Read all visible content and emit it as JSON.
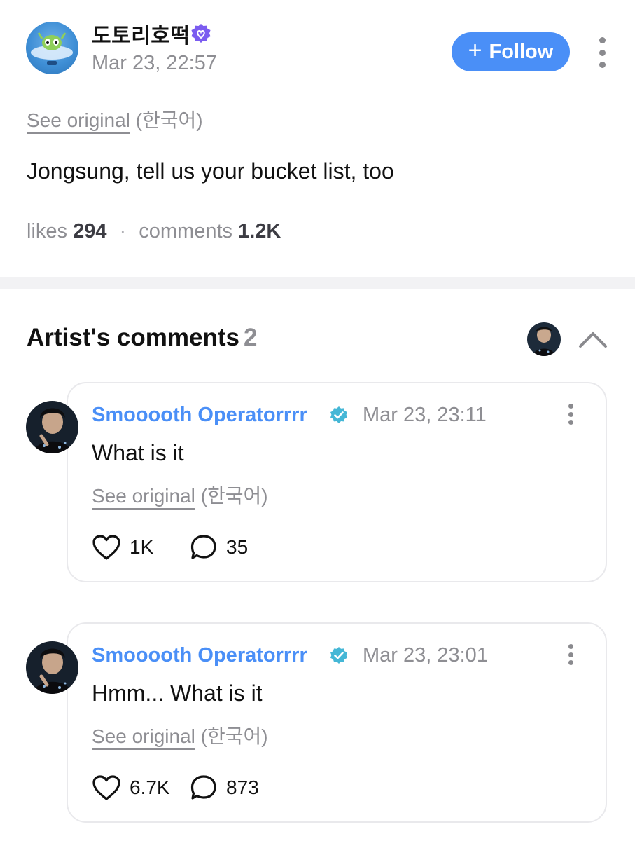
{
  "post": {
    "author": "도토리호떡",
    "timestamp": "Mar 23, 22:57",
    "follow_label": "Follow",
    "see_original_label": "See original",
    "original_language": "(한국어)",
    "text": "Jongsung, tell us your bucket list, too",
    "stats": {
      "likes_label": "likes",
      "likes_value": "294",
      "separator": "·",
      "comments_label": "comments",
      "comments_value": "1.2K"
    }
  },
  "artist_comments": {
    "title": "Artist's comments",
    "count": "2",
    "comments": [
      {
        "author": "Smooooth Operatorrrr",
        "timestamp": "Mar 23, 23:11",
        "text": "What is it",
        "see_original_label": "See original",
        "original_language": "(한국어)",
        "likes": "1K",
        "replies": "35"
      },
      {
        "author": "Smooooth Operatorrrr",
        "timestamp": "Mar 23, 23:01",
        "text": "Hmm... What is it",
        "see_original_label": "See original",
        "original_language": "(한국어)",
        "likes": "6.7K",
        "replies": "873"
      }
    ]
  },
  "colors": {
    "accent_blue": "#4a8ff7",
    "verified_teal": "#45b7d6",
    "verified_purple": "#7b5cf0",
    "muted_text": "#8e8e93",
    "divider": "#f2f2f4"
  },
  "icons": {
    "post_verified": "verified-heart-badge-icon",
    "comment_verified": "verified-check-badge-icon",
    "like": "heart-outline-icon",
    "reply": "speech-bubble-outline-icon",
    "more": "vertical-ellipsis-icon",
    "collapse": "chevron-up-icon",
    "follow": "plus-icon"
  }
}
